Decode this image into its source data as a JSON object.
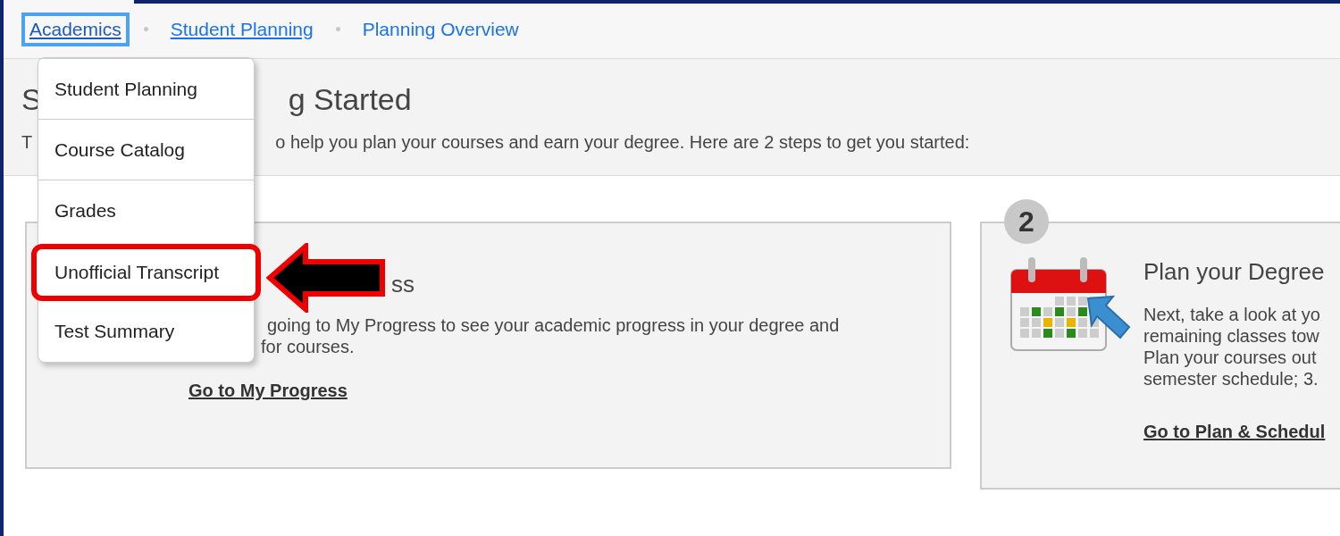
{
  "breadcrumb": [
    {
      "label": "Academics",
      "kind": "link",
      "focused": true
    },
    {
      "label": "Student Planning",
      "kind": "link",
      "focused": false
    },
    {
      "label": "Planning Overview",
      "kind": "current",
      "focused": false
    }
  ],
  "intro": {
    "heading_parts": [
      "S",
      "g Started"
    ],
    "text_parts": [
      "T",
      "o help you plan your courses and earn your degree. Here are 2 steps to get you started:"
    ]
  },
  "menu": {
    "items": [
      {
        "label": "Student Planning",
        "highlighted": false
      },
      {
        "label": "Course Catalog",
        "highlighted": false
      },
      {
        "label": "Grades",
        "highlighted": false
      },
      {
        "label": "Unofficial Transcript",
        "highlighted": true
      },
      {
        "label": "Test Summary",
        "highlighted": false
      }
    ]
  },
  "cards": [
    {
      "kind": "plain",
      "title_parts": [
        "ss"
      ],
      "text_lines": [
        "going to My Progress to see your academic progress in your degree and",
        "for courses."
      ],
      "link": "Go to My Progress"
    },
    {
      "kind": "calendar",
      "badge": "2",
      "title_parts": [
        "Plan your Degree"
      ],
      "text_lines": [
        "Next, take a look at yo",
        "remaining classes tow",
        "Plan your courses out",
        "semester schedule; 3."
      ],
      "link": "Go to Plan & Schedul"
    }
  ]
}
